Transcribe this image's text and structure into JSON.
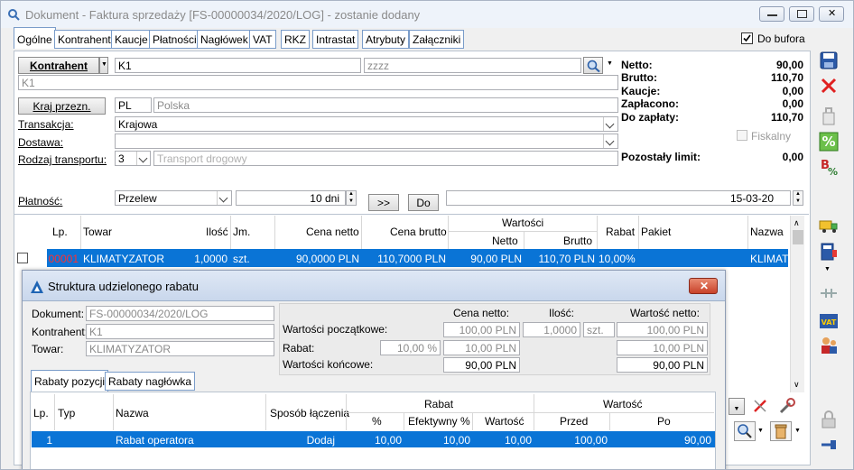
{
  "window": {
    "title": "Dokument - Faktura sprzedaży [FS-00000034/2020/LOG]  - zostanie dodany"
  },
  "tabs": [
    "Ogólne",
    "Kontrahent",
    "Kaucje",
    "Płatności",
    "Nagłówek",
    "VAT",
    "RKZ",
    "Intrastat",
    "Atrybuty",
    "Załączniki"
  ],
  "do_bufora": "Do bufora",
  "form": {
    "kontrahent_btn": "Kontrahent",
    "kontrahent_code": "K1",
    "kontrahent_search": "zzzz",
    "kontrahent_name": "K1",
    "kraj_btn": "Kraj przezn.",
    "kraj_code": "PL",
    "kraj_name": "Polska",
    "transakcja_label": "Transakcja:",
    "transakcja_value": "Krajowa",
    "dostawa_label": "Dostawa:",
    "dostawa_value": "",
    "rodzaj_label": "Rodzaj transportu:",
    "rodzaj_code": "3",
    "rodzaj_placeholder": "Transport drogowy",
    "platnosc_label": "Płatność:",
    "platnosc_value": "Przelew",
    "termin": "10 dni",
    "arrow_btn": ">>",
    "do_btn": "Do",
    "date": "15-03-20"
  },
  "summary": {
    "netto_label": "Netto:",
    "netto": "90,00",
    "brutto_label": "Brutto:",
    "brutto": "110,70",
    "kaucje_label": "Kaucje:",
    "kaucje": "0,00",
    "zaplacono_label": "Zapłacono:",
    "zaplacono": "0,00",
    "dozaplaty_label": "Do zapłaty:",
    "dozaplaty": "110,70",
    "fiskalny": "Fiskalny",
    "limit_label": "Pozostały limit:",
    "limit": "0,00"
  },
  "grid": {
    "headers": {
      "lp": "Lp.",
      "towar": "Towar",
      "ilosc": "Ilość",
      "jm": "Jm.",
      "cena_netto": "Cena netto",
      "cena_brutto": "Cena brutto",
      "wartosci": "Wartości",
      "netto": "Netto",
      "brutto": "Brutto",
      "rabat": "Rabat",
      "pakiet": "Pakiet",
      "nazwa": "Nazwa"
    },
    "row": {
      "lp": "00001",
      "towar": "KLIMATYZATOR",
      "ilosc": "1,0000",
      "jm": "szt.",
      "cena_netto": "90,0000 PLN",
      "cena_brutto": "110,7000 PLN",
      "netto": "90,00 PLN",
      "brutto": "110,70 PLN",
      "rabat": "10,00%",
      "nazwa": "KLIMATY"
    }
  },
  "dialog": {
    "title": "Struktura udzielonego rabatu",
    "dokument_label": "Dokument:",
    "dokument": "FS-00000034/2020/LOG",
    "kontrahent_label": "Kontrahent:",
    "kontrahent": "K1",
    "towar_label": "Towar:",
    "towar": "KLIMATYZATOR",
    "col_cena": "Cena netto:",
    "col_ilosc": "Ilość:",
    "col_wartosc": "Wartość netto:",
    "poczatkowe_label": "Wartości początkowe:",
    "poczatkowe_cena": "100,00 PLN",
    "poczatkowe_ilosc": "1,0000",
    "poczatkowe_jm": "szt.",
    "poczatkowe_wartosc": "100,00 PLN",
    "rabat_label": "Rabat:",
    "rabat_pct": "10,00 %",
    "rabat_cena": "10,00 PLN",
    "rabat_wartosc": "10,00 PLN",
    "koncowe_label": "Wartości końcowe:",
    "koncowe_cena": "90,00 PLN",
    "koncowe_wartosc": "90,00 PLN",
    "tab1": "Rabaty pozycji",
    "tab2": "Rabaty nagłówka",
    "grid": {
      "lp": "Lp.",
      "typ": "Typ",
      "nazwa": "Nazwa",
      "sposob": "Sposób łączenia",
      "rabat": "Rabat",
      "pct": "%",
      "efekt": "Efektywny %",
      "wartosc": "Wartość",
      "wartosc_grp": "Wartość",
      "przed": "Przed",
      "po": "Po",
      "row": {
        "lp": "1",
        "nazwa": "Rabat operatora",
        "sposob": "Dodaj",
        "pct": "10,00",
        "efekt": "10,00",
        "wartosc": "10,00",
        "przed": "100,00",
        "po": "90,00"
      }
    }
  },
  "colors": {
    "selection": "#0a74d6",
    "accent": "#1f64b4"
  }
}
